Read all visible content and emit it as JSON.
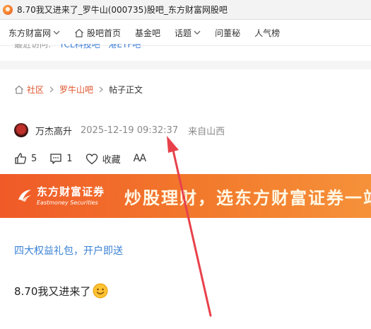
{
  "window": {
    "title": "8.70我又进来了_罗牛山(000735)股吧_东方财富网股吧"
  },
  "nav": {
    "items": [
      {
        "label": "东方财富网",
        "dropdown": true
      },
      {
        "label": "股吧首页",
        "icon": "home-icon"
      },
      {
        "label": "基金吧"
      },
      {
        "label": "话题",
        "dropdown": true
      },
      {
        "label": "问董秘"
      },
      {
        "label": "人气榜"
      }
    ]
  },
  "recent": {
    "label": "最近访问:",
    "links": [
      "TCL科技吧",
      "港ETF吧"
    ]
  },
  "breadcrumb": {
    "home": "社区",
    "bar": "罗牛山吧",
    "current": "帖子正文"
  },
  "author": {
    "name": "万杰高升",
    "time": "2025-12-19 09:32:37",
    "location": "来自山西"
  },
  "actions": {
    "like_count": "5",
    "comment_count": "1",
    "favorite_label": "收藏",
    "font_size_label": "AA"
  },
  "banner": {
    "brand_cn": "东方财富证券",
    "brand_en": "Eastmoney Securities",
    "slogan": "炒股理财，选东方财富证券一站"
  },
  "promo": {
    "text": "四大权益礼包，开户即送"
  },
  "post": {
    "text": "8.70我又进来了",
    "emoji": "smiley-icon"
  },
  "colors": {
    "accent": "#e0522b",
    "banner": "#f05a28",
    "link": "#3b82d6",
    "annotation_arrow": "#e8414b"
  }
}
